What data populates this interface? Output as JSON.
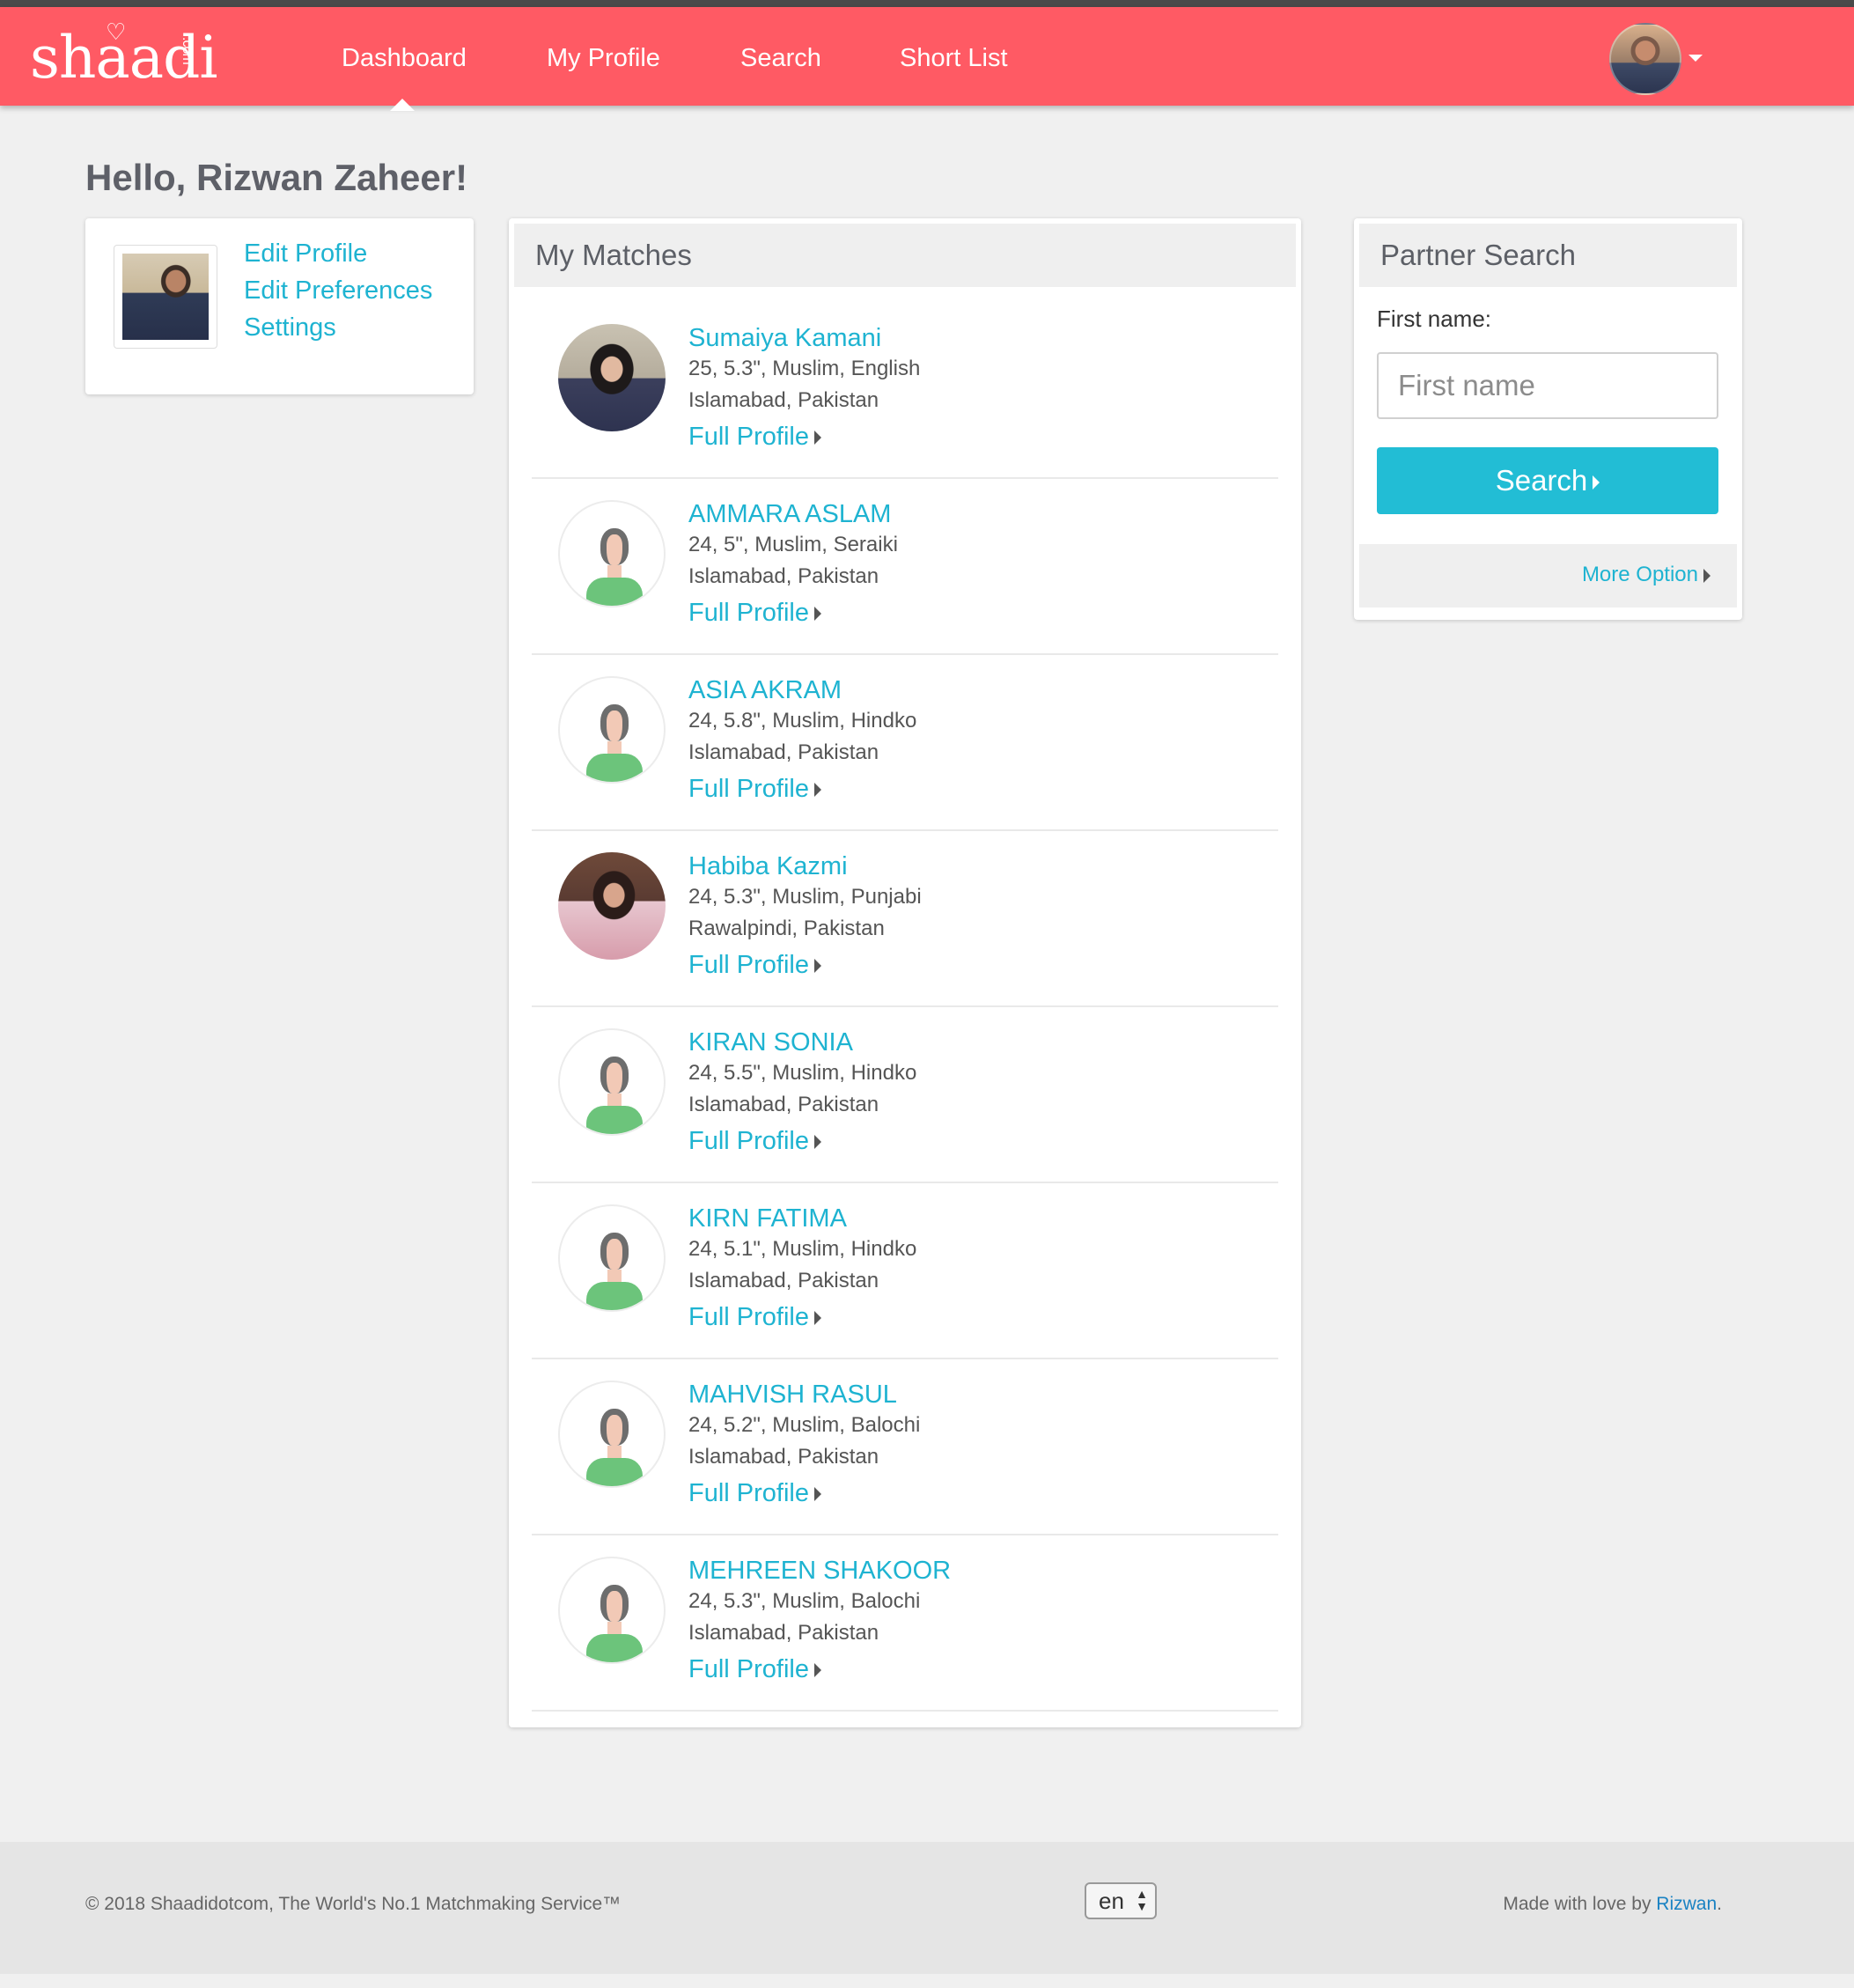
{
  "brand": {
    "logo_text": "shaadi",
    "logo_suffix": ".com",
    "logo_icon": "heart-icon"
  },
  "nav": {
    "items": [
      {
        "label": "Dashboard",
        "active": true
      },
      {
        "label": "My Profile",
        "active": false
      },
      {
        "label": "Search",
        "active": false
      },
      {
        "label": "Short List",
        "active": false
      }
    ],
    "avatar_icon": "user-avatar",
    "dropdown_icon": "caret-down-icon"
  },
  "greeting": "Hello, Rizwan Zaheer!",
  "profile_menu": {
    "links": [
      "Edit Profile",
      "Edit Preferences",
      "Settings"
    ]
  },
  "matches": {
    "title": "My Matches",
    "link_label": "Full Profile",
    "items": [
      {
        "name": "Sumaiya Kamani",
        "details": "25, 5.3\", Muslim, English",
        "location": "Islamabad,  Pakistan",
        "avatar": "photo"
      },
      {
        "name": "AMMARA ASLAM",
        "details": "24, 5\", Muslim, Seraiki",
        "location": "Islamabad,  Pakistan",
        "avatar": "placeholder"
      },
      {
        "name": "ASIA AKRAM",
        "details": "24, 5.8\", Muslim, Hindko",
        "location": "Islamabad,  Pakistan",
        "avatar": "placeholder"
      },
      {
        "name": "Habiba Kazmi",
        "details": "24, 5.3\", Muslim, Punjabi",
        "location": "Rawalpindi,  Pakistan",
        "avatar": "photo"
      },
      {
        "name": "KIRAN SONIA",
        "details": "24, 5.5\", Muslim, Hindko",
        "location": "Islamabad,  Pakistan",
        "avatar": "placeholder"
      },
      {
        "name": "KIRN FATIMA",
        "details": "24, 5.1\", Muslim, Hindko",
        "location": "Islamabad,  Pakistan",
        "avatar": "placeholder"
      },
      {
        "name": "MAHVISH RASUL",
        "details": "24, 5.2\", Muslim, Balochi",
        "location": "Islamabad,  Pakistan",
        "avatar": "placeholder"
      },
      {
        "name": "MEHREEN SHAKOOR",
        "details": "24, 5.3\", Muslim, Balochi",
        "location": "Islamabad,  Pakistan",
        "avatar": "placeholder"
      }
    ]
  },
  "partner_search": {
    "title": "Partner Search",
    "first_name_label": "First name:",
    "first_name_placeholder": "First name",
    "first_name_value": "",
    "search_label": "Search",
    "more_option_label": "More Option"
  },
  "footer": {
    "copyright": "© 2018 Shaadidotcom, The World's No.1 Matchmaking Service™",
    "language": "en",
    "made_with": "Made with love by ",
    "author": "Rizwan",
    "made_suffix": "."
  },
  "colors": {
    "brand": "#ff5a64",
    "accent": "#1eb3d1",
    "button": "#22bdd5"
  }
}
